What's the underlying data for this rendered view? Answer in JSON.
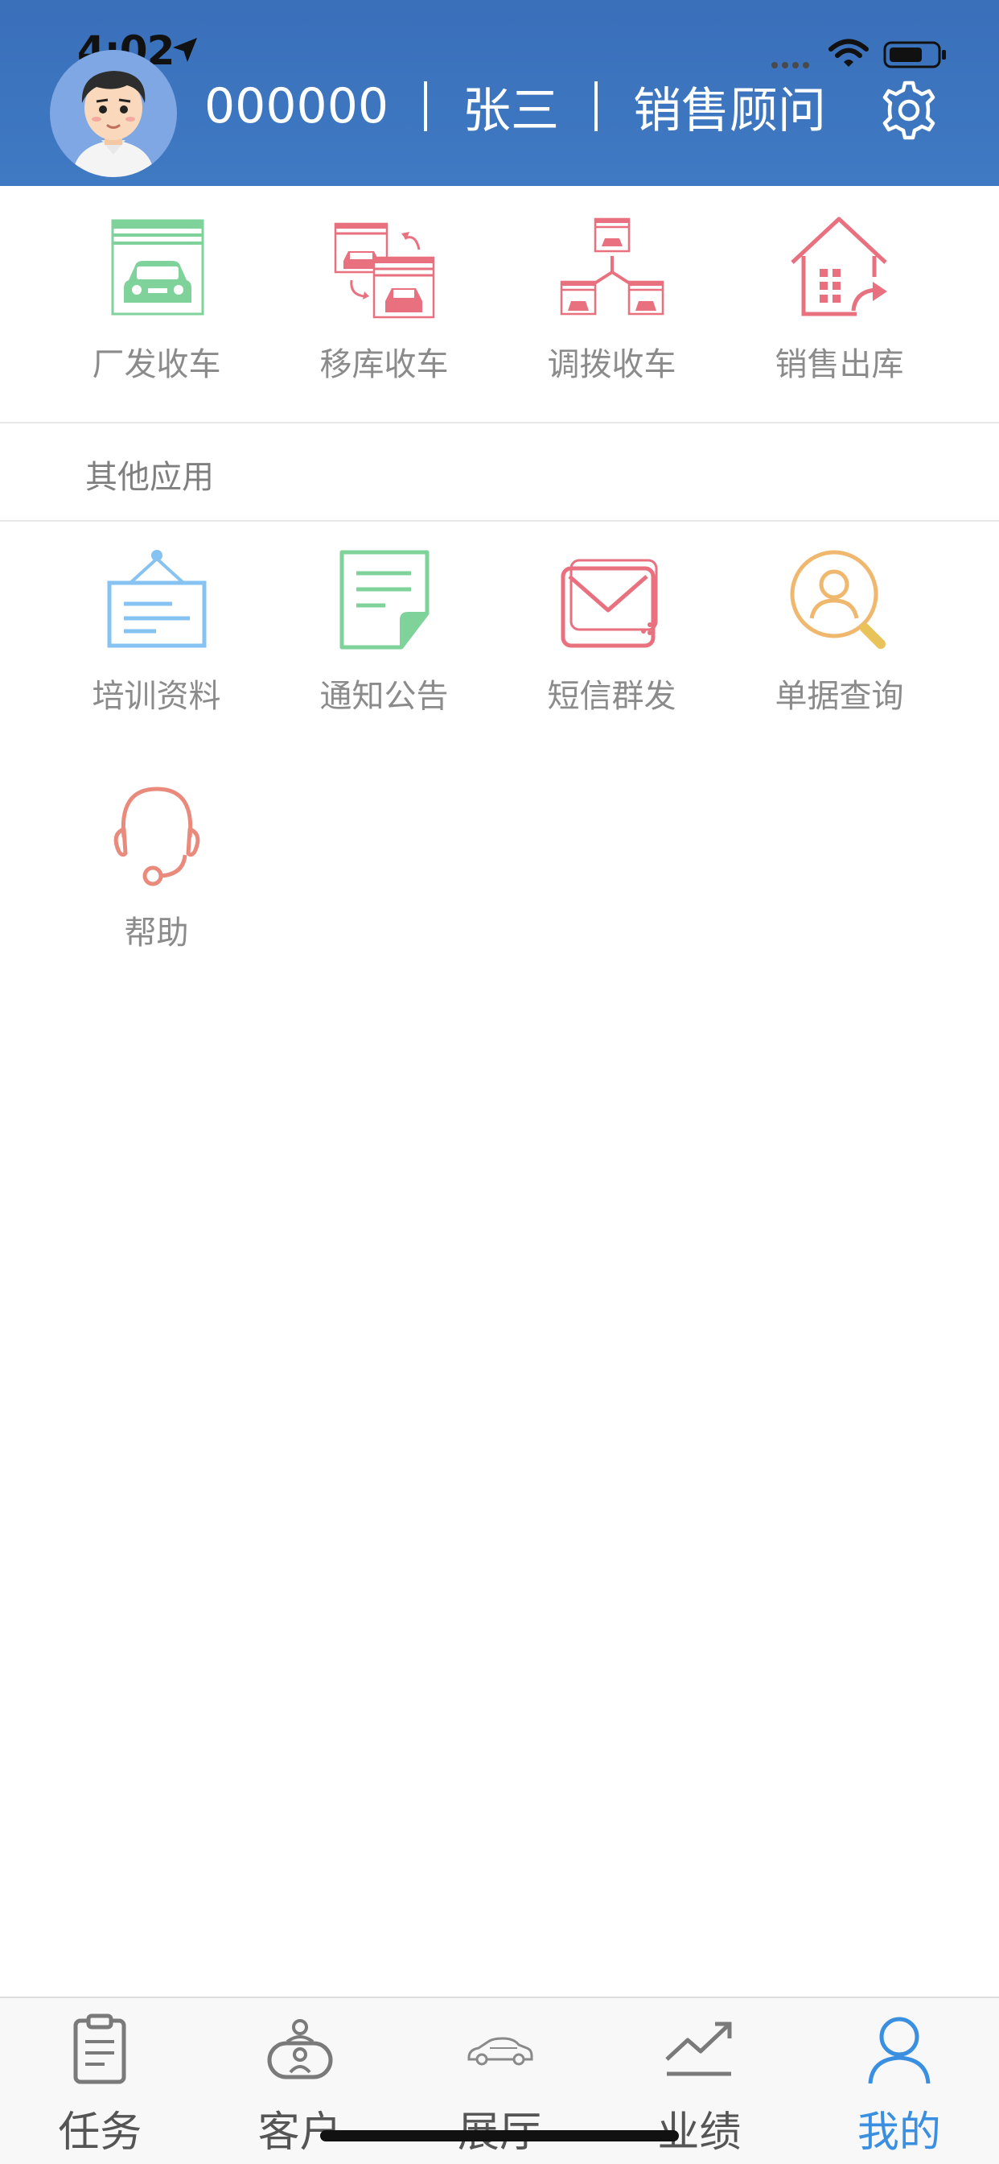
{
  "status_bar": {
    "time": "4:02"
  },
  "header": {
    "user_id": "000000",
    "name": "张三",
    "role": "销售顾问"
  },
  "top_actions": [
    {
      "label": "厂发收车",
      "icon": "factory-delivery-icon"
    },
    {
      "label": "移库收车",
      "icon": "transfer-warehouse-icon"
    },
    {
      "label": "调拨收车",
      "icon": "allocation-icon"
    },
    {
      "label": "销售出库",
      "icon": "sales-outbound-icon"
    }
  ],
  "other_apps": {
    "title": "其他应用",
    "items": [
      {
        "label": "培训资料",
        "icon": "training-board-icon"
      },
      {
        "label": "通知公告",
        "icon": "notice-document-icon"
      },
      {
        "label": "短信群发",
        "icon": "sms-envelope-icon"
      },
      {
        "label": "单据查询",
        "icon": "user-search-icon"
      },
      {
        "label": "帮助",
        "icon": "headset-icon"
      }
    ]
  },
  "tabbar": {
    "active": "我的",
    "items": [
      {
        "label": "任务",
        "icon": "clipboard-icon"
      },
      {
        "label": "客户",
        "icon": "customer-icon"
      },
      {
        "label": "展厅",
        "icon": "car-icon"
      },
      {
        "label": "业绩",
        "icon": "trend-icon"
      },
      {
        "label": "我的",
        "icon": "person-icon"
      }
    ]
  },
  "colors": {
    "header_blue": "#3d76c0",
    "accent_blue": "#3a8fe0",
    "green_icon": "#7fd39a",
    "red_icon": "#e8707f",
    "light_blue_icon": "#86c3f2",
    "orange_icon": "#f0b86e",
    "coral_icon": "#ea8a7c"
  }
}
